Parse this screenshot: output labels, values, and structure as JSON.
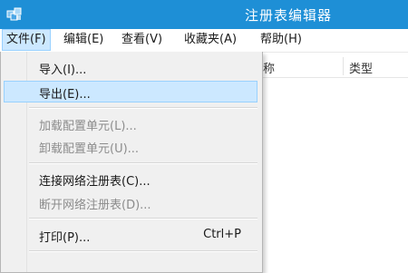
{
  "window": {
    "title": "注册表编辑器",
    "icon": "registry-editor-icon",
    "accent_color": "#1e8fd6"
  },
  "menubar": {
    "items": [
      {
        "label": "文件(F)"
      },
      {
        "label": "编辑(E)"
      },
      {
        "label": "查看(V)"
      },
      {
        "label": "收藏夹(A)"
      },
      {
        "label": "帮助(H)"
      }
    ]
  },
  "list": {
    "columns": [
      "称",
      "类型"
    ]
  },
  "file_menu": {
    "items": [
      {
        "label": "导入(I)...",
        "enabled": true
      },
      {
        "label": "导出(E)...",
        "enabled": true,
        "highlighted": true
      },
      {
        "label": "加载配置单元(L)...",
        "enabled": false
      },
      {
        "label": "卸载配置单元(U)...",
        "enabled": false
      },
      {
        "label": "连接网络注册表(C)...",
        "enabled": true
      },
      {
        "label": "断开网络注册表(D)...",
        "enabled": false
      },
      {
        "label": "打印(P)...",
        "enabled": true,
        "shortcut": "Ctrl+P"
      }
    ]
  }
}
